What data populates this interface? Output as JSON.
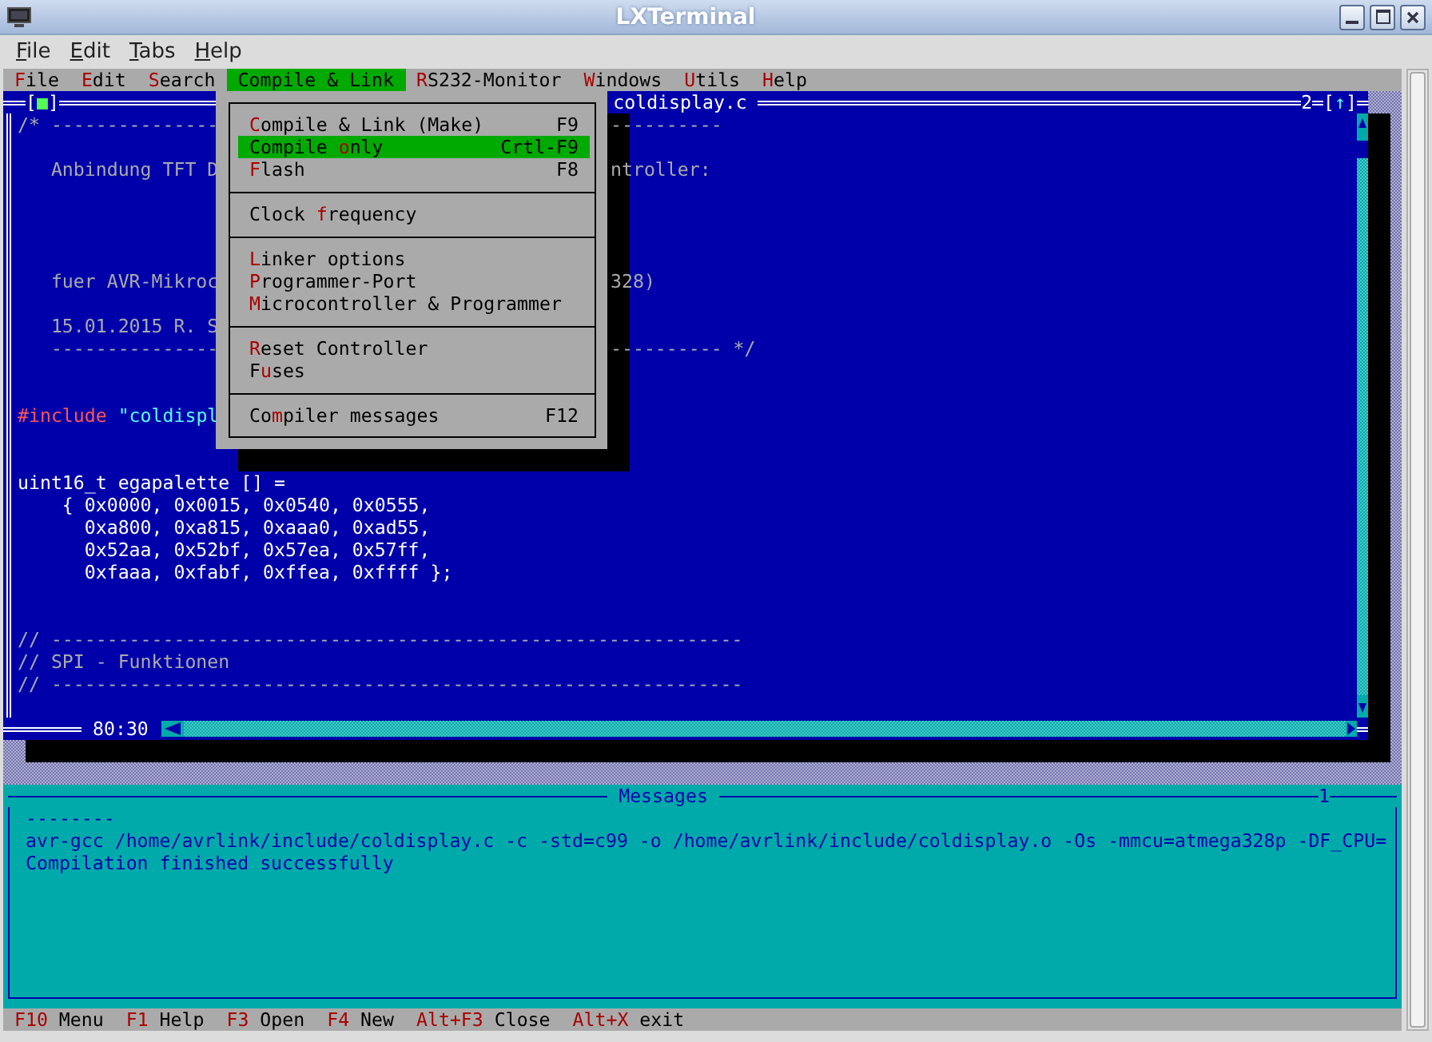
{
  "window": {
    "title": "LXTerminal"
  },
  "menubar": [
    "File",
    "Edit",
    "Tabs",
    "Help"
  ],
  "tui_menu": [
    {
      "key": "F",
      "rest": "ile",
      "selected": false
    },
    {
      "key": "E",
      "rest": "dit",
      "selected": false
    },
    {
      "key": "S",
      "rest": "earch",
      "selected": false
    },
    {
      "key": "C",
      "rest": "ompile & Link",
      "selected": true
    },
    {
      "key": "R",
      "rest": "S232-Monitor",
      "selected": false
    },
    {
      "key": "W",
      "rest": "indows",
      "selected": false
    },
    {
      "key": "U",
      "rest": "tils",
      "selected": false
    },
    {
      "key": "H",
      "rest": "elp",
      "selected": false
    }
  ],
  "dropdown": {
    "groups": [
      [
        {
          "key": "C",
          "post": "ompile & Link (Make)",
          "shortcut": "F9",
          "selected": false
        },
        {
          "pre": "Compile ",
          "key": "o",
          "post": "nly",
          "shortcut": "Crtl-F9",
          "selected": true
        },
        {
          "key": "F",
          "post": "lash",
          "shortcut": "F8",
          "selected": false
        }
      ],
      [
        {
          "pre": "Clock ",
          "key": "f",
          "post": "requency",
          "selected": false
        }
      ],
      [
        {
          "key": "L",
          "post": "inker options",
          "selected": false
        },
        {
          "key": "P",
          "post": "rogrammer-Port",
          "selected": false
        },
        {
          "key": "M",
          "post": "icrocontroller & Programmer",
          "selected": false
        }
      ],
      [
        {
          "key": "R",
          "post": "eset Controller",
          "selected": false
        },
        {
          "pre": "F",
          "key": "u",
          "post": "ses",
          "selected": false
        }
      ],
      [
        {
          "pre": "Co",
          "key": "m",
          "post": "piler messages",
          "shortcut": "F12",
          "selected": false
        }
      ]
    ]
  },
  "editor": {
    "close_box": "[■]",
    "title": "coldisplay.c",
    "number": "2",
    "zoom_box": "[↑]",
    "position": "80:30",
    "lines": [
      {
        "kind": "text",
        "segments": [
          {
            "kind": "comment",
            "text": "/* ---------------"
          }
        ],
        "right": "----------"
      },
      {
        "kind": "blank"
      },
      {
        "kind": "text",
        "segments": [
          {
            "kind": "comment",
            "text": "   Anbindung TFT D"
          }
        ],
        "right": "ntroller:"
      },
      {
        "kind": "blank"
      },
      {
        "kind": "blank"
      },
      {
        "kind": "blank"
      },
      {
        "kind": "blank"
      },
      {
        "kind": "text",
        "segments": [
          {
            "kind": "comment",
            "text": "   fuer AVR-Mikroc"
          }
        ],
        "right": "328)"
      },
      {
        "kind": "blank"
      },
      {
        "kind": "text",
        "segments": [
          {
            "kind": "comment",
            "text": "   15.01.2015 R. S"
          }
        ]
      },
      {
        "kind": "text",
        "segments": [
          {
            "kind": "comment",
            "text": "   ---------------"
          }
        ],
        "right": "---------- */"
      },
      {
        "kind": "blank"
      },
      {
        "kind": "blank"
      },
      {
        "kind": "text",
        "segments": [
          {
            "kind": "directive",
            "text": "#include "
          },
          {
            "kind": "string",
            "text": "\"coldispl"
          }
        ]
      },
      {
        "kind": "blank"
      },
      {
        "kind": "blank"
      },
      {
        "kind": "text",
        "segments": [
          {
            "kind": "code",
            "text": "uint16_t egapalette [] ="
          }
        ]
      },
      {
        "kind": "text",
        "segments": [
          {
            "kind": "code",
            "text": "    { 0x0000, 0x0015, 0x0540, 0x0555,"
          }
        ]
      },
      {
        "kind": "text",
        "segments": [
          {
            "kind": "code",
            "text": "      0xa800, 0xa815, 0xaaa0, 0xad55,"
          }
        ]
      },
      {
        "kind": "text",
        "segments": [
          {
            "kind": "code",
            "text": "      0x52aa, 0x52bf, 0x57ea, 0x57ff,"
          }
        ]
      },
      {
        "kind": "text",
        "segments": [
          {
            "kind": "code",
            "text": "      0xfaaa, 0xfabf, 0xffea, 0xffff };"
          }
        ]
      },
      {
        "kind": "blank"
      },
      {
        "kind": "blank"
      },
      {
        "kind": "text",
        "segments": [
          {
            "kind": "comment",
            "text": "// --------------------------------------------------------------"
          }
        ]
      },
      {
        "kind": "text",
        "segments": [
          {
            "kind": "comment",
            "text": "// SPI - Funktionen"
          }
        ]
      },
      {
        "kind": "text",
        "segments": [
          {
            "kind": "comment",
            "text": "// --------------------------------------------------------------"
          }
        ]
      },
      {
        "kind": "blank"
      }
    ]
  },
  "messages": {
    "title": "Messages",
    "number": "1",
    "lines": [
      "--------",
      "avr-gcc /home/avrlink/include/coldisplay.c -c -std=c99 -o /home/avrlink/include/coldisplay.o -Os -mmcu=atmega328p -DF_CPU=",
      "Compilation finished successfully"
    ]
  },
  "status_bar": [
    {
      "key": "F10",
      "label": "Menu"
    },
    {
      "key": "F1",
      "label": "Help"
    },
    {
      "key": "F3",
      "label": "Open"
    },
    {
      "key": "F4",
      "label": "New"
    },
    {
      "key": "Alt+F3",
      "label": "Close"
    },
    {
      "key": "Alt+X",
      "label": "exit"
    }
  ]
}
